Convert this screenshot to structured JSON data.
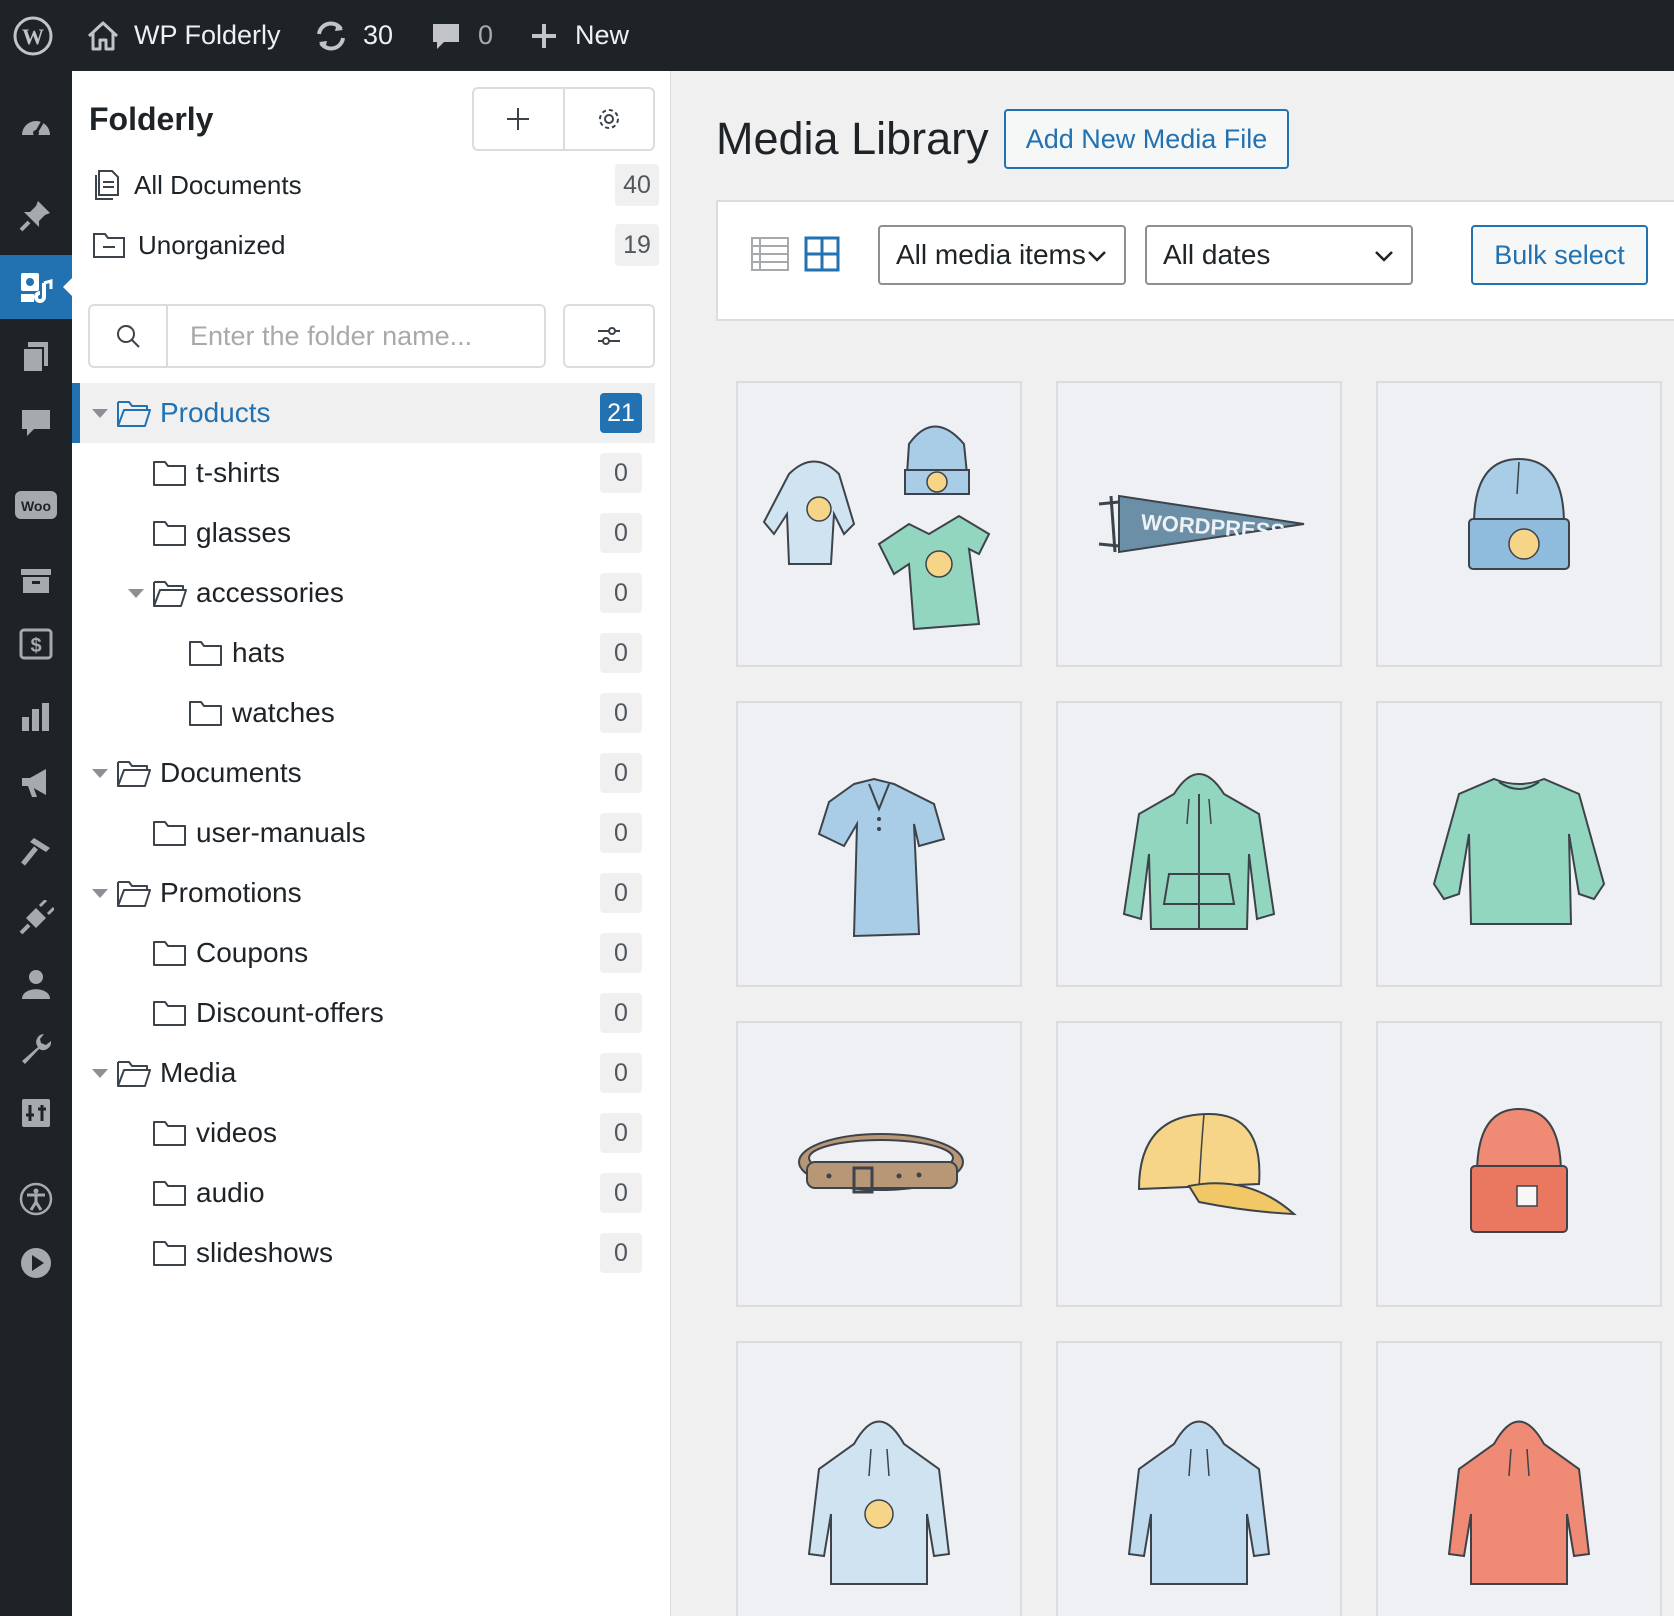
{
  "adminbar": {
    "site_name": "WP Folderly",
    "updates_count": "30",
    "comments_count": "0",
    "new_label": "New"
  },
  "admin_menu": {
    "items": [
      {
        "icon": "dashboard-icon"
      },
      {
        "icon": "pin-icon"
      },
      {
        "icon": "media-icon",
        "active": true
      },
      {
        "icon": "pages-icon"
      },
      {
        "icon": "comments-icon"
      },
      {
        "icon": "woo-icon",
        "text": "Woo"
      },
      {
        "icon": "archive-icon"
      },
      {
        "icon": "dollar-icon"
      },
      {
        "icon": "analytics-icon"
      },
      {
        "icon": "megaphone-icon"
      },
      {
        "icon": "appearance-icon"
      },
      {
        "icon": "plugins-icon"
      },
      {
        "icon": "users-icon"
      },
      {
        "icon": "tools-icon"
      },
      {
        "icon": "settings-icon"
      },
      {
        "icon": "accessibility-icon"
      },
      {
        "icon": "play-icon"
      }
    ]
  },
  "folder_panel": {
    "title": "Folderly",
    "all_documents": {
      "label": "All Documents",
      "count": "40"
    },
    "unorganized": {
      "label": "Unorganized",
      "count": "19"
    },
    "search_placeholder": "Enter the folder name...",
    "tree": [
      {
        "name": "Products",
        "count": "21",
        "level": 0,
        "expanded": true,
        "selected": true
      },
      {
        "name": "t-shirts",
        "count": "0",
        "level": 1
      },
      {
        "name": "glasses",
        "count": "0",
        "level": 1
      },
      {
        "name": "accessories",
        "count": "0",
        "level": 1,
        "expanded": true
      },
      {
        "name": "hats",
        "count": "0",
        "level": 2
      },
      {
        "name": "watches",
        "count": "0",
        "level": 2
      },
      {
        "name": "Documents",
        "count": "0",
        "level": 0,
        "expanded": true
      },
      {
        "name": "user-manuals",
        "count": "0",
        "level": 1
      },
      {
        "name": "Promotions",
        "count": "0",
        "level": 0,
        "expanded": true
      },
      {
        "name": "Coupons",
        "count": "0",
        "level": 1
      },
      {
        "name": "Discount-offers",
        "count": "0",
        "level": 1
      },
      {
        "name": "Media",
        "count": "0",
        "level": 0,
        "expanded": true
      },
      {
        "name": "videos",
        "count": "0",
        "level": 1
      },
      {
        "name": "audio",
        "count": "0",
        "level": 1
      },
      {
        "name": "slideshows",
        "count": "0",
        "level": 1
      }
    ]
  },
  "main": {
    "title": "Media Library",
    "add_new_label": "Add New Media File",
    "filter_type": "All media items",
    "filter_date": "All dates",
    "bulk_select_label": "Bulk select",
    "view_mode": "grid",
    "media": [
      {
        "name": "clothing-set-thumbnail"
      },
      {
        "name": "wordpress-pennant-thumbnail",
        "text": "WORDPRESS"
      },
      {
        "name": "blue-beanie-thumbnail"
      },
      {
        "name": "polo-shirt-thumbnail"
      },
      {
        "name": "green-hoodie-thumbnail"
      },
      {
        "name": "long-sleeve-tee-thumbnail"
      },
      {
        "name": "belt-thumbnail"
      },
      {
        "name": "yellow-cap-thumbnail"
      },
      {
        "name": "orange-beanie-thumbnail"
      },
      {
        "name": "hoodie-with-logo-thumbnail"
      },
      {
        "name": "blue-hoodie-thumbnail"
      },
      {
        "name": "orange-hoodie-thumbnail"
      }
    ]
  },
  "colors": {
    "accent": "#2271b1",
    "adminbar_bg": "#1d2327",
    "blue_apparel": "#a9cde6",
    "green_apparel": "#93d6c0",
    "orange_apparel": "#ef8a74",
    "yellow_apparel": "#f6d488",
    "belt_brown": "#b89776"
  }
}
